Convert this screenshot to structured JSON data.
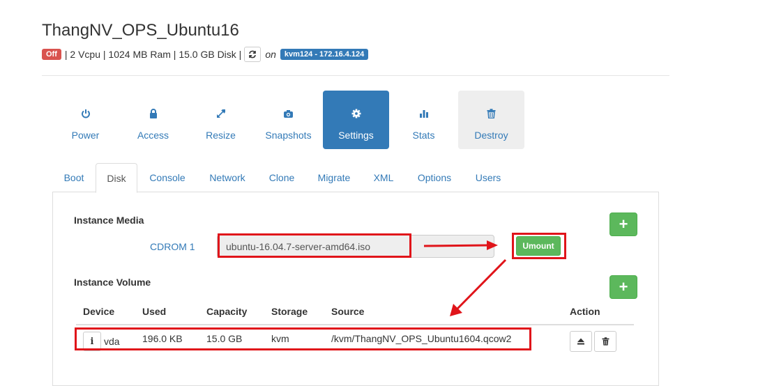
{
  "instance": {
    "name": "ThangNV_OPS_Ubuntu16",
    "status": "Off",
    "specs": "| 2 Vcpu | 1024 MB Ram | 15.0 GB Disk |",
    "on_label": "on",
    "host": "kvm124 - 172.16.4.124"
  },
  "colors": {
    "primary": "#337ab7",
    "danger": "#d9534f",
    "success": "#5cb85c",
    "annotation": "#e0141a"
  },
  "action_pills": [
    {
      "label": "Power",
      "icon": "power-icon"
    },
    {
      "label": "Access",
      "icon": "lock-icon"
    },
    {
      "label": "Resize",
      "icon": "resize-icon"
    },
    {
      "label": "Snapshots",
      "icon": "camera-icon"
    },
    {
      "label": "Settings",
      "icon": "gear-icon",
      "active": true
    },
    {
      "label": "Stats",
      "icon": "bar-chart-icon"
    },
    {
      "label": "Destroy",
      "icon": "trash-icon"
    }
  ],
  "tabs": [
    {
      "label": "Boot"
    },
    {
      "label": "Disk",
      "active": true
    },
    {
      "label": "Console"
    },
    {
      "label": "Network"
    },
    {
      "label": "Clone"
    },
    {
      "label": "Migrate"
    },
    {
      "label": "XML"
    },
    {
      "label": "Options"
    },
    {
      "label": "Users"
    }
  ],
  "media": {
    "title": "Instance Media",
    "add_label": "+",
    "cdrom_label": "CDROM 1",
    "cdrom_value": "ubuntu-16.04.7-server-amd64.iso",
    "umount_label": "Umount"
  },
  "volume": {
    "title": "Instance Volume",
    "add_label": "+",
    "headers": {
      "device": "Device",
      "used": "Used",
      "capacity": "Capacity",
      "storage": "Storage",
      "source": "Source",
      "action": "Action"
    },
    "rows": [
      {
        "info": "i",
        "device": "vda",
        "used": "196.0 KB",
        "capacity": "15.0 GB",
        "storage": "kvm",
        "source": "/kvm/ThangNV_OPS_Ubuntu1604.qcow2"
      }
    ]
  }
}
